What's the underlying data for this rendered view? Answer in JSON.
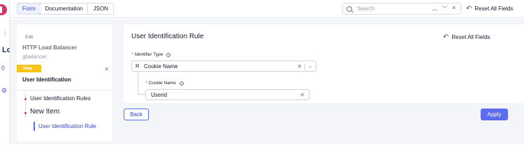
{
  "app_strip": {
    "grip_icon": "grid-icon",
    "title_fragment": "Lo",
    "icons": [
      "logo-icon",
      "search-icon",
      "gear-icon"
    ]
  },
  "topbar": {
    "tabs": [
      {
        "label": "Form",
        "active": true
      },
      {
        "label": "Documentation",
        "active": false
      },
      {
        "label": "JSON",
        "active": false
      }
    ],
    "search": {
      "placeholder": "Search"
    },
    "reset_label": "Reset All Fields"
  },
  "sidebar": {
    "edit_label": "Edit",
    "object_title": "HTTP Load Balancer",
    "object_subtitle": "gbalancer",
    "badge": "New",
    "section_title": "User Identification",
    "tree": [
      {
        "label": "User Identification Rules"
      },
      {
        "label": "New Item"
      }
    ],
    "selected_item": "User Identification Rule"
  },
  "form": {
    "title": "User Identification Rule",
    "reset_label": "Reset All Fields",
    "identifier_type": {
      "label": "Identifier Type",
      "required_mark": "*",
      "value": "Cookie Name",
      "icon": "cookie-icon"
    },
    "cookie_name": {
      "label": "Cookie Name",
      "required_mark": "*",
      "value": "Userid"
    }
  },
  "footer": {
    "back_label": "Back",
    "apply_label": "Apply"
  },
  "colors": {
    "accent": "#4f6df5",
    "apply_bg": "#5b6cf0",
    "badge_new": "#f5c518",
    "required": "#d6336c",
    "background": "#f4f5f9"
  }
}
